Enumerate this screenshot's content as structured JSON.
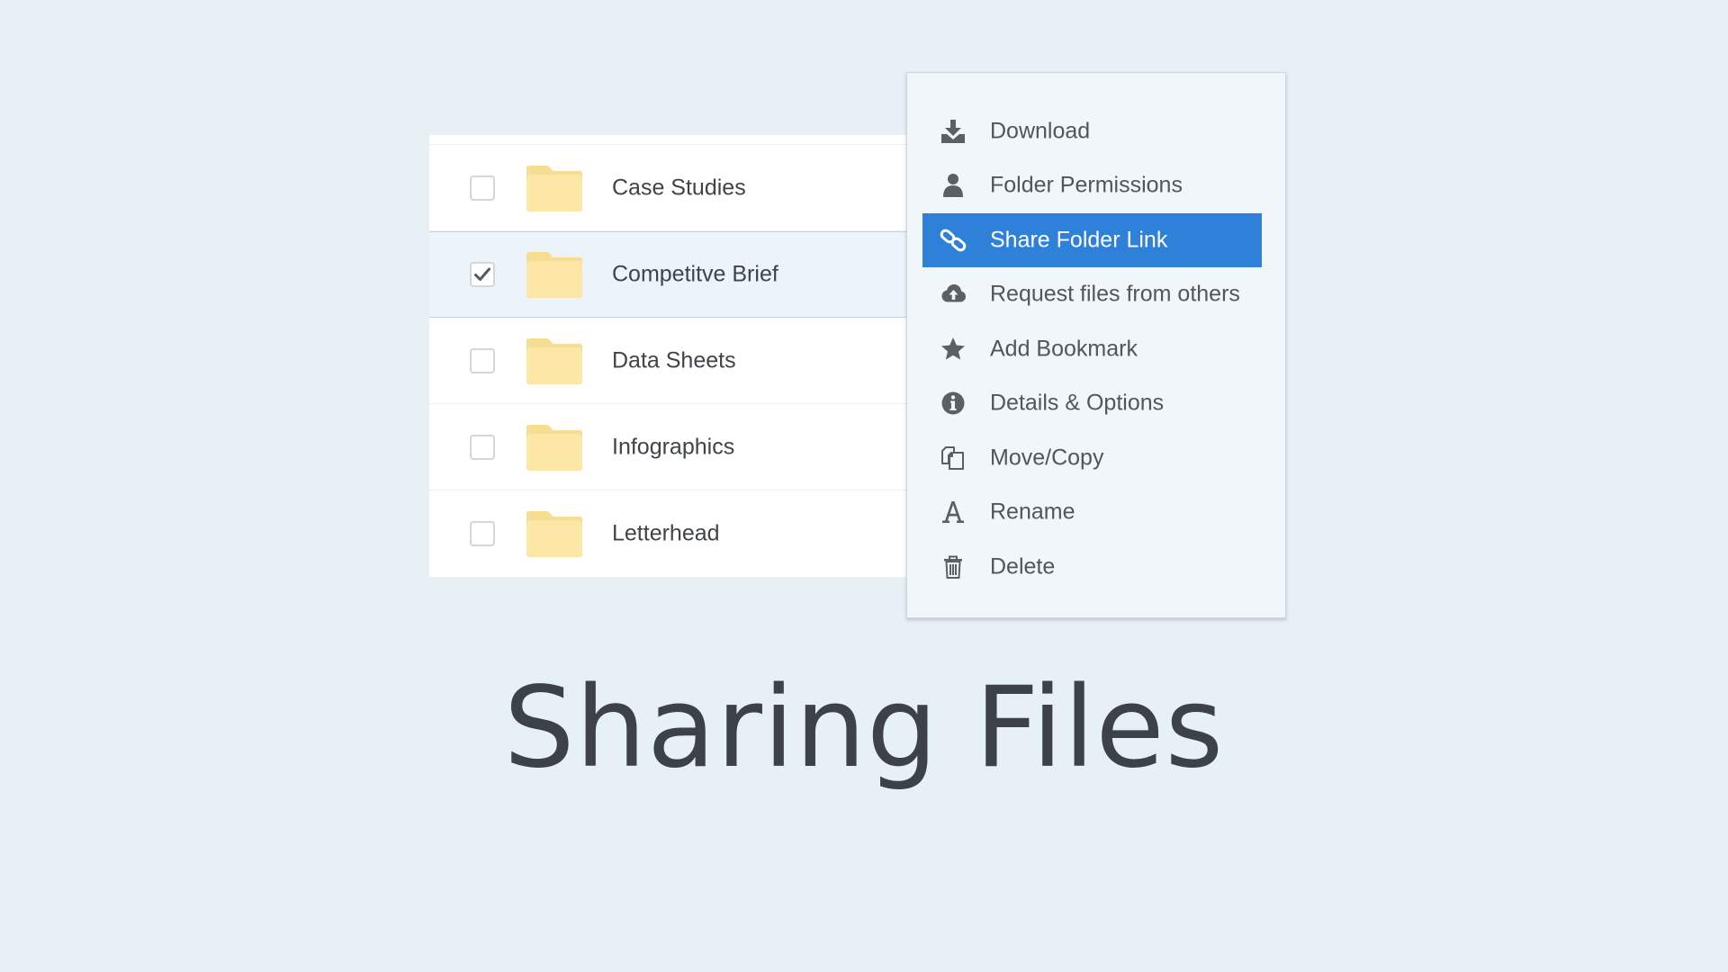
{
  "folders": [
    {
      "name": "Case Studies",
      "checked": false
    },
    {
      "name": "Competitve Brief",
      "checked": true
    },
    {
      "name": "Data Sheets",
      "checked": false
    },
    {
      "name": "Infographics",
      "checked": false
    },
    {
      "name": "Letterhead",
      "checked": false
    }
  ],
  "context_menu": {
    "items": [
      {
        "label": "Download",
        "icon": "download-icon"
      },
      {
        "label": "Folder Permissions",
        "icon": "user-icon"
      },
      {
        "label": "Share Folder Link",
        "icon": "link-icon",
        "active": true
      },
      {
        "label": "Request files from others",
        "icon": "cloud-upload-icon"
      },
      {
        "label": "Add Bookmark",
        "icon": "star-icon"
      },
      {
        "label": "Details & Options",
        "icon": "info-icon"
      },
      {
        "label": "Move/Copy",
        "icon": "copy-icon"
      },
      {
        "label": "Rename",
        "icon": "font-a-icon"
      },
      {
        "label": "Delete",
        "icon": "trash-icon"
      }
    ]
  },
  "caption": "Sharing Files",
  "colors": {
    "background": "#e7f0f5",
    "accent": "#2f80d8",
    "folder": "#fce7a6",
    "selected_row": "#ecf3f9",
    "menu_background": "#f1f6fb",
    "icon": "#5a6166"
  }
}
